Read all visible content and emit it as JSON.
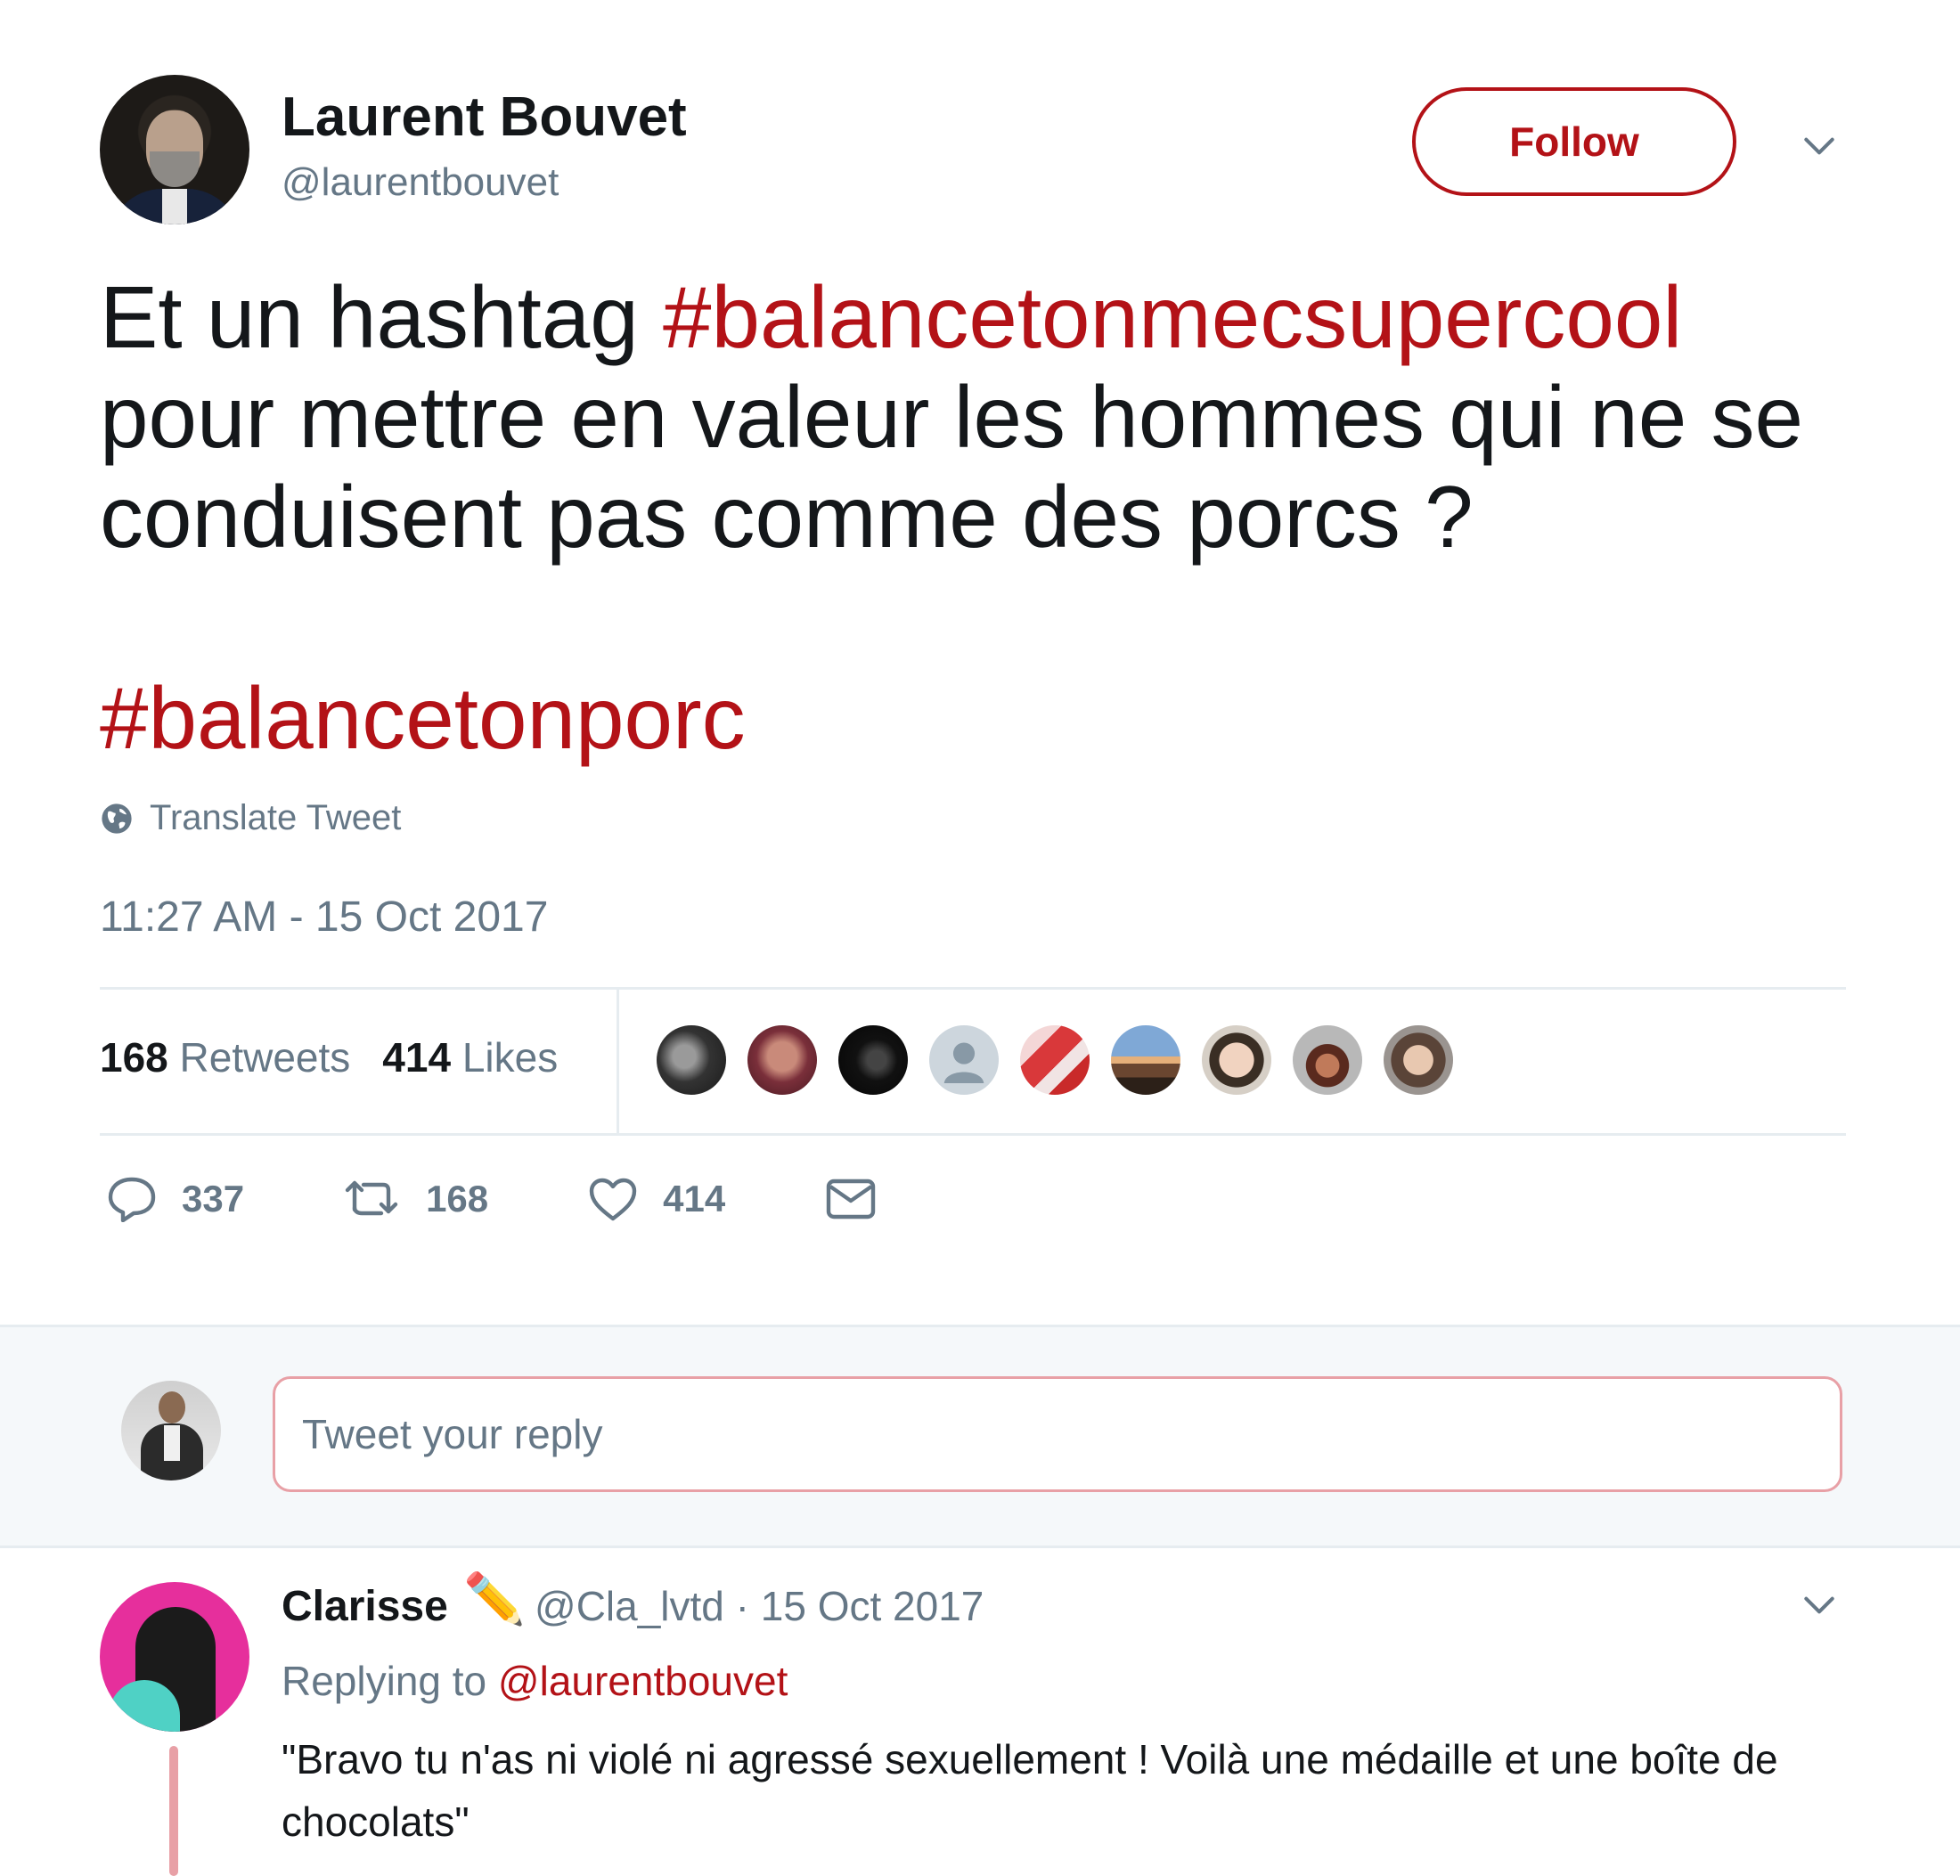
{
  "author": {
    "name": "Laurent Bouvet",
    "handle": "@laurentbouvet",
    "follow_label": "Follow"
  },
  "tweet": {
    "text_before": "Et un hashtag ",
    "hashtag_1": "#balancetonmecsupercool",
    "text_after": " pour mettre en valeur les hommes qui ne se conduisent pas comme des porcs ?",
    "hashtag_2": "#balancetonporc",
    "translate_label": "Translate Tweet",
    "timestamp": "11:27 AM - 15 Oct 2017"
  },
  "stats": {
    "retweets_count": "168",
    "retweets_label": "Retweets",
    "likes_count": "414",
    "likes_label": "Likes"
  },
  "actions": {
    "reply_count": "337",
    "retweet_count": "168",
    "like_count": "414"
  },
  "composer": {
    "placeholder": "Tweet your reply"
  },
  "reply": {
    "name": "Clarisse",
    "emoji": "✏️",
    "meta": "@Cla_lvtd · 15 Oct 2017",
    "replying_prefix": "Replying to ",
    "replying_handle": "@laurentbouvet",
    "text": "\"Bravo tu n'as ni violé ni agressé sexuellement ! Voilà une médaille et une boîte de chocolats\""
  },
  "colors": {
    "accent": "#b31217",
    "secondary_text": "#657786",
    "divider": "#e6ecf0"
  }
}
